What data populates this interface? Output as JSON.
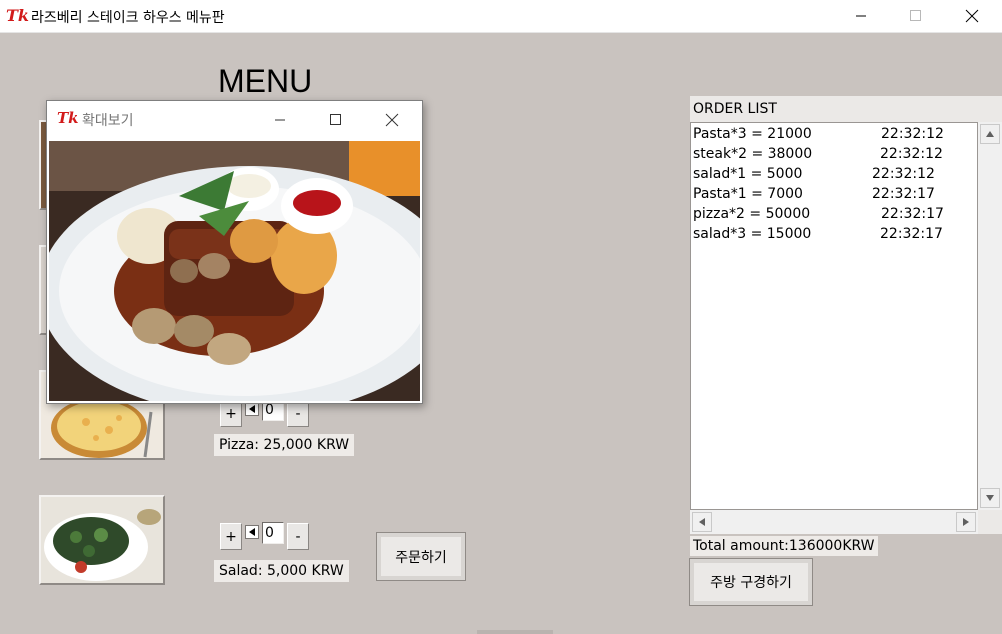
{
  "window": {
    "title": "라즈베리 스테이크 하우스 메뉴판",
    "logo": "Tk"
  },
  "menu": {
    "heading": "MENU",
    "order_button": "주문하기",
    "items": [
      {
        "name": "pizza",
        "price_label": "Pizza: 25,000 KRW",
        "qty": "0",
        "plus": "+",
        "minus": "-"
      },
      {
        "name": "salad",
        "price_label": "Salad: 5,000 KRW",
        "qty": "0",
        "plus": "+",
        "minus": "-"
      }
    ]
  },
  "popup": {
    "title": "확대보기",
    "logo": "Tk",
    "image": "steak-photo"
  },
  "order": {
    "label": "ORDER LIST",
    "rows": [
      {
        "text": "Pasta*3 = 21000",
        "time": "22:32:12"
      },
      {
        "text": "steak*2 = 38000",
        "time": "22:32:12"
      },
      {
        "text": "salad*1 = 5000",
        "time": "22:32:12"
      },
      {
        "text": "Pasta*1 = 7000",
        "time": "22:32:17"
      },
      {
        "text": "pizza*2 = 50000",
        "time": "22:32:17"
      },
      {
        "text": "salad*3 = 15000",
        "time": "22:32:17"
      }
    ],
    "total": "Total amount:136000KRW",
    "kitchen_button": "주방 구경하기"
  },
  "colors": {
    "background": "#c9c3bf",
    "logo_red": "#d21a1a"
  }
}
